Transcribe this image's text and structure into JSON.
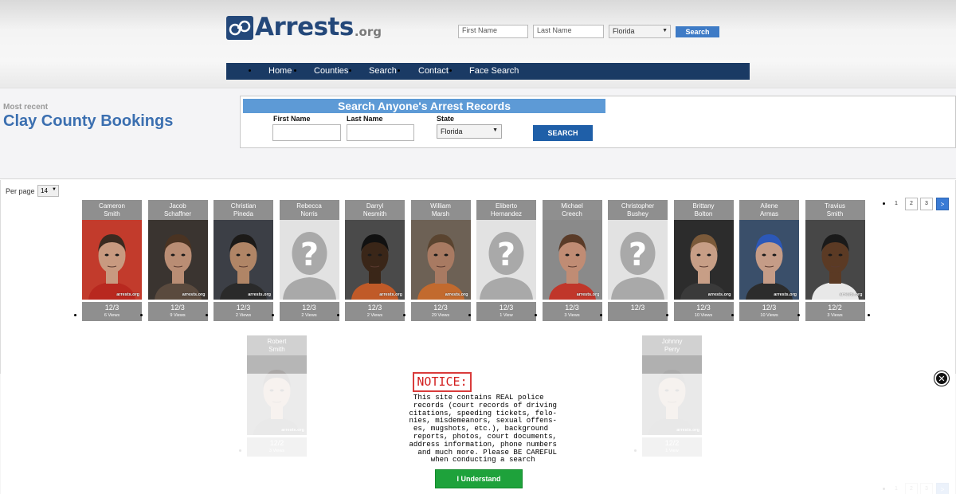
{
  "header": {
    "logo_text": "Arrests",
    "logo_suffix": ".org",
    "first_name_placeholder": "First Name",
    "last_name_placeholder": "Last Name",
    "state_value": "Florida",
    "search_label": "Search"
  },
  "nav": {
    "items": [
      "Home",
      "Counties",
      "Search",
      "Contact",
      "Face Search"
    ]
  },
  "banner": {
    "subtitle": "Most recent",
    "title": "Clay County Bookings",
    "search_title": "Search Anyone's Arrest Records",
    "first_name_label": "First Name",
    "last_name_label": "Last Name",
    "state_label": "State",
    "state_value": "Florida",
    "search_button": "SEARCH"
  },
  "listing": {
    "per_page_label": "Per page",
    "per_page_value": "14",
    "pager": {
      "pages": [
        "1",
        "2",
        "3"
      ],
      "next": ">"
    },
    "watermark": "arrests.org",
    "bookings": [
      {
        "first": "Cameron",
        "last": "Smith",
        "date": "12/3",
        "views": "6 Views",
        "photo": true,
        "bg": "#c23b2c",
        "skin": "#c89a80",
        "hair": "#3a2a20",
        "shirt": "#b8281f"
      },
      {
        "first": "Jacob",
        "last": "Schaffner",
        "date": "12/3",
        "views": "9 Views",
        "photo": true,
        "bg": "#3a3430",
        "skin": "#b98d74",
        "hair": "#4a3322",
        "shirt": "#5a4a3e"
      },
      {
        "first": "Christian",
        "last": "Pineda",
        "date": "12/3",
        "views": "2 Views",
        "photo": true,
        "bg": "#3c3f46",
        "skin": "#b08566",
        "hair": "#1c1a18",
        "shirt": "#2a2a2a"
      },
      {
        "first": "Rebecca",
        "last": "Norris",
        "date": "12/3",
        "views": "2 Views",
        "photo": false
      },
      {
        "first": "Darryl",
        "last": "Nesmith",
        "date": "12/3",
        "views": "2 Views",
        "photo": true,
        "bg": "#4a4a4a",
        "skin": "#3a2618",
        "hair": "#111111",
        "shirt": "#c05a28"
      },
      {
        "first": "William",
        "last": "Marsh",
        "date": "12/3",
        "views": "29 Views",
        "photo": true,
        "bg": "#6d6155",
        "skin": "#a87a62",
        "hair": "#5a4430",
        "shirt": "#c26a2e"
      },
      {
        "first": "Eliberto",
        "last": "Hernandez",
        "date": "12/3",
        "views": "1 View",
        "photo": false
      },
      {
        "first": "Michael",
        "last": "Creech",
        "date": "12/3",
        "views": "3 Views",
        "photo": true,
        "bg": "#8a8a8a",
        "skin": "#c08c74",
        "hair": "#5a3b28",
        "shirt": "#c0362a"
      },
      {
        "first": "Christopher",
        "last": "Bushey",
        "date": "12/3",
        "views": "",
        "photo": false
      },
      {
        "first": "Brittany",
        "last": "Bolton",
        "date": "12/3",
        "views": "10 Views",
        "photo": true,
        "bg": "#2c2c2c",
        "skin": "#c79e86",
        "hair": "#7b5a3a",
        "shirt": "#3a3a3a"
      },
      {
        "first": "Ailene",
        "last": "Armas",
        "date": "12/3",
        "views": "10 Views",
        "photo": true,
        "bg": "#3a4f6a",
        "skin": "#c59c87",
        "hair": "#2c58b8",
        "shirt": "#2c2c2c"
      },
      {
        "first": "Travius",
        "last": "Smith",
        "date": "12/2",
        "views": "3 Views",
        "photo": true,
        "bg": "#474747",
        "skin": "#5b3a24",
        "hair": "#1a1a1a",
        "shirt": "#e8e8e8"
      },
      {
        "first": "Robert",
        "last": "Smith",
        "date": "12/2",
        "views": "3 Views",
        "photo": true,
        "bg": "#4a4a4a",
        "skin": "#b58a72",
        "hair": "#2a2420",
        "shirt": "#3a3a3a"
      },
      {
        "first": "Johnny",
        "last": "Perry",
        "date": "12/2",
        "views": "1 View",
        "photo": true,
        "bg": "#3d3d3d",
        "skin": "#b08a72",
        "hair": "#2a2a2a",
        "shirt": "#333333"
      }
    ]
  },
  "notice": {
    "title": "NOTICE:",
    "lines": [
      "  This site contains REAL police",
      "  records (court records of driving",
      " citations, speeding tickets, felo-",
      " nies, misdemeanors, sexual offens-",
      "  es, mugshots, etc.), background",
      "  reports, photos, court documents,",
      " address information, phone numbers",
      "   and much more. Please BE CAREFUL",
      "      when conducting a search"
    ],
    "button": "I Understand",
    "close": "✕"
  }
}
